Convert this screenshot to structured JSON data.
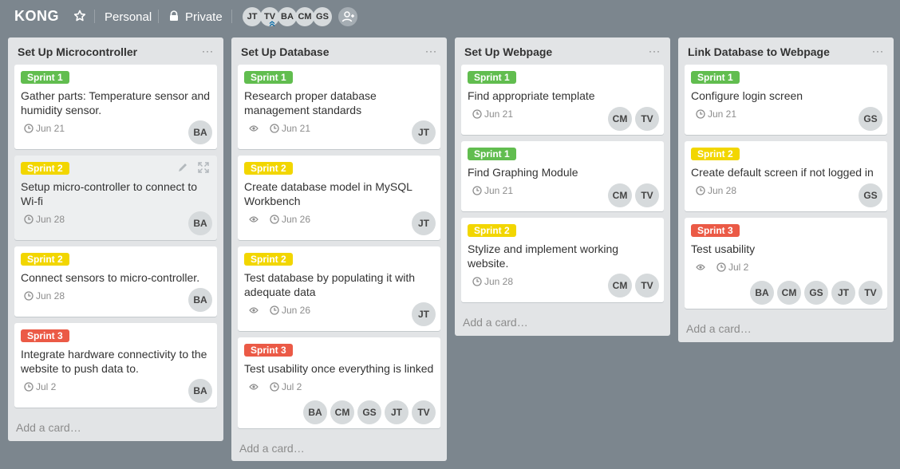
{
  "header": {
    "title": "KONG",
    "team": "Personal",
    "visibility": "Private",
    "members": [
      "JT",
      "TV",
      "BA",
      "CM",
      "GS"
    ]
  },
  "colors": {
    "sprint1": "#61bd4f",
    "sprint2": "#f2d600",
    "sprint3": "#eb5a46"
  },
  "lists": [
    {
      "title": "Set Up Microcontroller",
      "add_card": "Add a card…",
      "cards": [
        {
          "label": "Sprint 1",
          "title": "Gather parts: Temperature sensor and humidity sensor.",
          "due": "Jun 21",
          "members": [
            "BA"
          ]
        },
        {
          "label": "Sprint 2",
          "title": "Setup micro-controller to connect to Wi-fi",
          "due": "Jun 28",
          "members": [
            "BA"
          ]
        },
        {
          "label": "Sprint 2",
          "title": "Connect sensors to micro-controller.",
          "due": "Jun 28",
          "members": [
            "BA"
          ]
        },
        {
          "label": "Sprint 3",
          "title": "Integrate hardware connectivity to the website to push data to.",
          "due": "Jul 2",
          "members": [
            "BA"
          ]
        }
      ]
    },
    {
      "title": "Set Up Database",
      "add_card": "Add a card…",
      "cards": [
        {
          "label": "Sprint 1",
          "title": "Research proper database management standards",
          "due": "Jun 21",
          "members": [
            "JT"
          ]
        },
        {
          "label": "Sprint 2",
          "title": "Create database model in MySQL Workbench",
          "due": "Jun 26",
          "members": [
            "JT"
          ]
        },
        {
          "label": "Sprint 2",
          "title": "Test database by populating it with adequate data",
          "due": "Jun 26",
          "members": [
            "JT"
          ]
        },
        {
          "label": "Sprint 3",
          "title": "Test usability once everything is linked",
          "due": "Jul 2",
          "members": [
            "BA",
            "CM",
            "GS",
            "JT",
            "TV"
          ]
        }
      ]
    },
    {
      "title": "Set Up Webpage",
      "add_card": "Add a card…",
      "cards": [
        {
          "label": "Sprint 1",
          "title": "Find appropriate template",
          "due": "Jun 21",
          "members": [
            "CM",
            "TV"
          ]
        },
        {
          "label": "Sprint 1",
          "title": "Find Graphing Module",
          "due": "Jun 21",
          "members": [
            "CM",
            "TV"
          ]
        },
        {
          "label": "Sprint 2",
          "title": "Stylize and implement working website.",
          "due": "Jun 28",
          "members": [
            "CM",
            "TV"
          ]
        }
      ]
    },
    {
      "title": "Link Database to Webpage",
      "add_card": "Add a card…",
      "cards": [
        {
          "label": "Sprint 1",
          "title": "Configure login screen",
          "due": "Jun 21",
          "members": [
            "GS"
          ]
        },
        {
          "label": "Sprint 2",
          "title": "Create default screen if not logged in",
          "due": "Jun 28",
          "members": [
            "GS"
          ]
        },
        {
          "label": "Sprint 3",
          "title": "Test usability",
          "due": "Jul 2",
          "members": [
            "BA",
            "CM",
            "GS",
            "JT",
            "TV"
          ]
        }
      ]
    }
  ]
}
